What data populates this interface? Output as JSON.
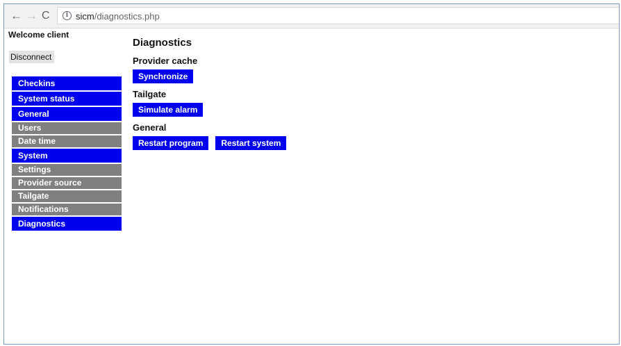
{
  "browser": {
    "back_icon": "←",
    "forward_icon": "→",
    "reload_icon": "C",
    "info_icon": "i",
    "url_host": "sicm",
    "url_path": "/diagnostics.php"
  },
  "session": {
    "welcome": "Welcome client",
    "disconnect_label": "Disconnect"
  },
  "menu": {
    "items": [
      {
        "label": "Checkins",
        "style": "blue"
      },
      {
        "label": "System status",
        "style": "blue"
      },
      {
        "label": "General",
        "style": "blue"
      },
      {
        "label": "Users",
        "style": "gray"
      },
      {
        "label": "Date time",
        "style": "gray"
      },
      {
        "label": "System",
        "style": "blue"
      },
      {
        "label": "Settings",
        "style": "gray"
      },
      {
        "label": "Provider source",
        "style": "gray"
      },
      {
        "label": "Tailgate",
        "style": "gray"
      },
      {
        "label": "Notifications",
        "style": "gray"
      },
      {
        "label": "Diagnostics",
        "style": "blue"
      }
    ]
  },
  "content": {
    "title": "Diagnostics",
    "sections": {
      "provider_cache": {
        "heading": "Provider cache",
        "synchronize_label": "Synchronize"
      },
      "tailgate": {
        "heading": "Tailgate",
        "simulate_alarm_label": "Simulate alarm"
      },
      "general": {
        "heading": "General",
        "restart_program_label": "Restart program",
        "restart_system_label": "Restart system"
      }
    }
  },
  "colors": {
    "menu_blue": "#0000ee",
    "menu_gray": "#808080",
    "button_blue": "#0000ee"
  }
}
